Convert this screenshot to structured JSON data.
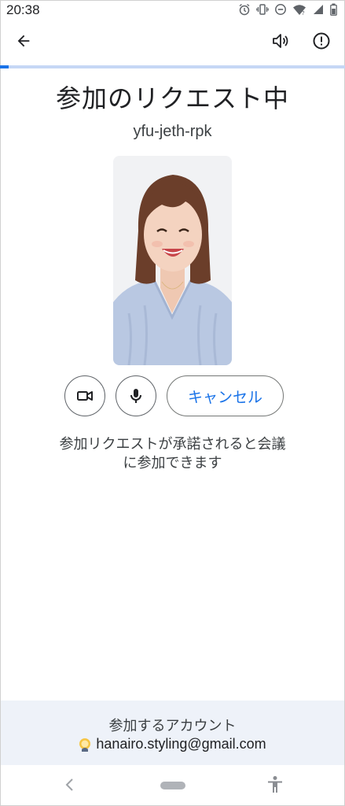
{
  "status_bar": {
    "time": "20:38",
    "icons": [
      "alarm-icon",
      "vibrate-icon",
      "dnd-icon",
      "wifi-icon",
      "signal-icon",
      "battery-icon"
    ]
  },
  "app_bar": {
    "icons": [
      "back-arrow-icon",
      "volume-icon",
      "report-icon"
    ]
  },
  "progress": {
    "fraction": 0.025,
    "color": "#1a73e8",
    "track_color": "#c6d7f5"
  },
  "main": {
    "title": "参加のリクエスト中",
    "meeting_code": "yfu-jeth-rpk",
    "controls": {
      "camera_icon": "videocam-icon",
      "mic_icon": "mic-icon",
      "cancel_label": "キャンセル"
    },
    "hint_line1": "参加リクエストが承諾されると会議",
    "hint_line2": "に参加できます"
  },
  "account": {
    "heading": "参加するアカウント",
    "email": "hanairo.styling@gmail.com",
    "avatar_icon": "account-avatar-icon"
  },
  "nav_bar": {
    "icons": [
      "nav-back-icon",
      "home-pill",
      "accessibility-icon"
    ]
  },
  "colors": {
    "accent": "#1a73e8",
    "panel_bg": "#eef2f9",
    "text": "#202124"
  }
}
